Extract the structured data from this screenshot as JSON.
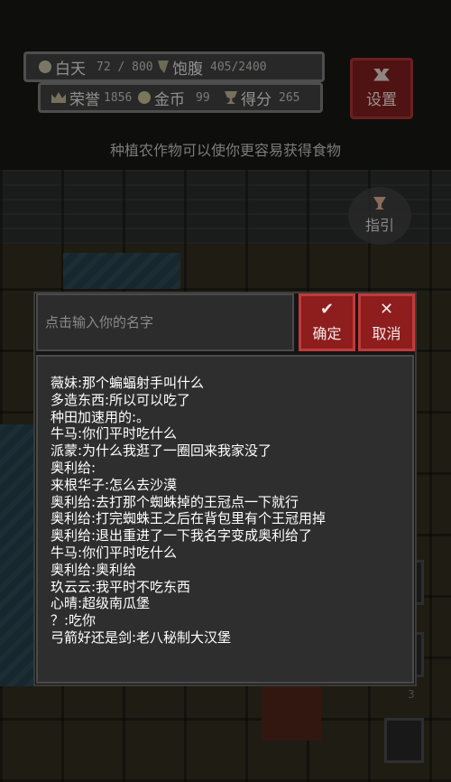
{
  "hud": {
    "day_label": "白天",
    "day_value": "72 / 800",
    "satiety_label": "饱腹",
    "satiety_value": "405/2400",
    "honor_label": "荣誉",
    "honor_value": "1856",
    "gold_label": "金币",
    "gold_value": "99",
    "score_label": "得分",
    "score_value": "265",
    "settings_label": "设置"
  },
  "hint_text": "种植农作物可以使你更容易获得食物",
  "guide_label": "指引",
  "side_counter": "3",
  "dialog": {
    "input_placeholder": "点击输入你的名字",
    "confirm_label": "确定",
    "cancel_label": "取消",
    "messages": [
      "薇妹:那个蝙蝠射手叫什么",
      "多造东西:所以可以吃了",
      "种田加速用的:。",
      "牛马:你们平时吃什么",
      "派蒙:为什么我逛了一圈回来我家没了",
      "奥利给:",
      "来根华子:怎么去沙漠",
      "奥利给:去打那个蜘蛛掉的王冠点一下就行",
      "奥利给:打完蜘蛛王之后在背包里有个王冠用掉",
      "奥利给:退出重进了一下我名字变成奥利给了",
      "牛马:你们平时吃什么",
      "奥利给:奥利给",
      "玖云云:我平时不吃东西",
      "心晴:超级南瓜堡",
      "？:吃你",
      "弓箭好还是剑:老八秘制大汉堡"
    ]
  },
  "colors": {
    "button_red": "#8e1d1d",
    "panel_grey": "#2e2e2e",
    "text_white": "#ffffff"
  }
}
